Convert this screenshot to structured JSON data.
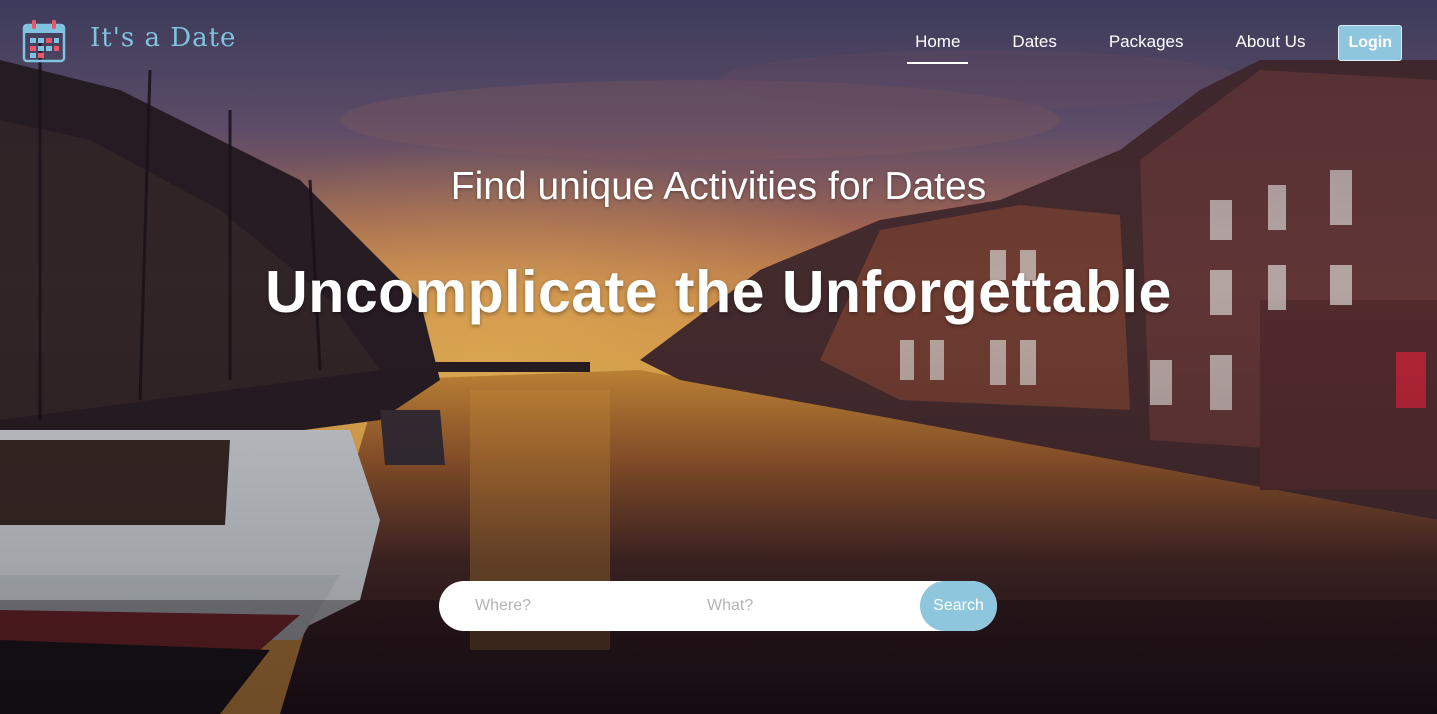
{
  "brand": {
    "name": "It's a Date",
    "icon": "calendar-icon",
    "color": "#7fc3df"
  },
  "nav": {
    "items": [
      {
        "label": "Home",
        "active": true
      },
      {
        "label": "Dates",
        "active": false
      },
      {
        "label": "Packages",
        "active": false
      },
      {
        "label": "About Us",
        "active": false
      }
    ],
    "login_label": "Login"
  },
  "hero": {
    "subtitle": "Find unique Activities for Dates",
    "headline": "Uncomplicate the Unforgettable",
    "background": "city-canal-sunset-photo"
  },
  "search": {
    "where_placeholder": "Where?",
    "what_placeholder": "What?",
    "button_label": "Search"
  },
  "colors": {
    "accent": "#8ec6de",
    "text_light": "#ffffff"
  }
}
